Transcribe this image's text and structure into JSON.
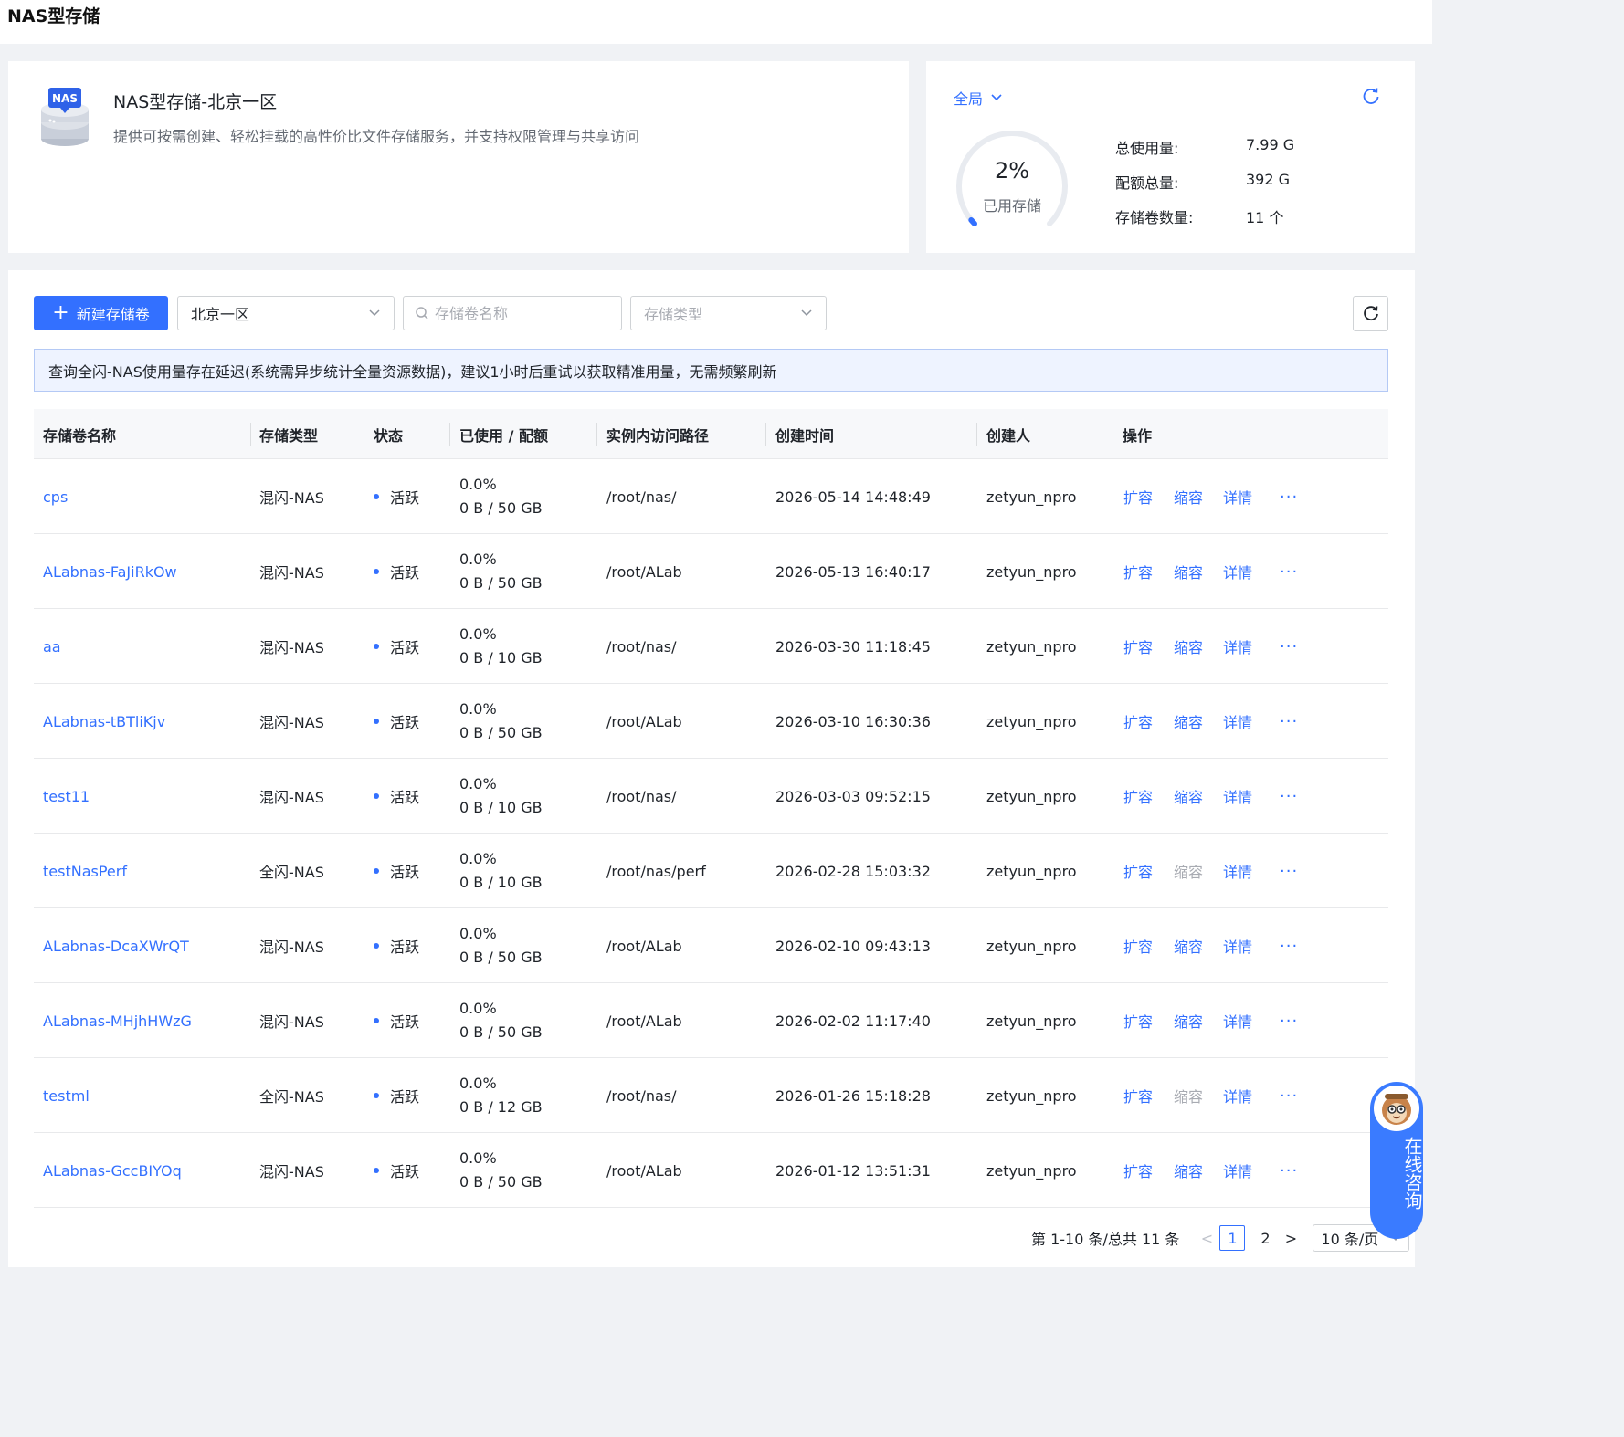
{
  "page": {
    "title": "NAS型存储"
  },
  "info": {
    "logo_text": "NAS",
    "title": "NAS型存储-北京一区",
    "description": "提供可按需创建、轻松挂载的高性价比文件存储服务，并支持权限管理与共享访问"
  },
  "stats": {
    "scope": "全局",
    "used_percent_value": 2,
    "used_percent": "2%",
    "used_label": "已用存储",
    "total_usage_label": "总使用量:",
    "total_usage": "7.99 G",
    "quota_label": "配额总量:",
    "quota": "392 G",
    "volume_count_label": "存储卷数量:",
    "volume_count": "11 个",
    "accent": "#3370ff"
  },
  "toolbar": {
    "new_label": "新建存储卷",
    "region": "北京一区",
    "search_placeholder": "存储卷名称",
    "type_placeholder": "存储类型"
  },
  "notice": "查询全闪-NAS使用量存在延迟(系统需异步统计全量资源数据)，建议1小时后重试以获取精准用量，无需频繁刷新",
  "table": {
    "headers": {
      "name": "存储卷名称",
      "type": "存储类型",
      "status": "状态",
      "usage": "已使用 / 配额",
      "path": "实例内访问路径",
      "created": "创建时间",
      "creator": "创建人",
      "actions": "操作"
    },
    "action_labels": {
      "expand": "扩容",
      "shrink": "缩容",
      "detail": "详情",
      "more": "···"
    },
    "rows": [
      {
        "name": "cps",
        "type": "混闪-NAS",
        "status": "活跃",
        "pct": "0.0%",
        "usage": "0 B / 50 GB",
        "path": "/root/nas/",
        "created": "2026-05-14 14:48:49",
        "creator": "zetyun_npro",
        "shrink_enabled": true
      },
      {
        "name": "ALabnas-FaJiRkOw",
        "type": "混闪-NAS",
        "status": "活跃",
        "pct": "0.0%",
        "usage": "0 B / 50 GB",
        "path": "/root/ALab",
        "created": "2026-05-13 16:40:17",
        "creator": "zetyun_npro",
        "shrink_enabled": true
      },
      {
        "name": "aa",
        "type": "混闪-NAS",
        "status": "活跃",
        "pct": "0.0%",
        "usage": "0 B / 10 GB",
        "path": "/root/nas/",
        "created": "2026-03-30 11:18:45",
        "creator": "zetyun_npro",
        "shrink_enabled": true
      },
      {
        "name": "ALabnas-tBTliKjv",
        "type": "混闪-NAS",
        "status": "活跃",
        "pct": "0.0%",
        "usage": "0 B / 50 GB",
        "path": "/root/ALab",
        "created": "2026-03-10 16:30:36",
        "creator": "zetyun_npro",
        "shrink_enabled": true
      },
      {
        "name": "test11",
        "type": "混闪-NAS",
        "status": "活跃",
        "pct": "0.0%",
        "usage": "0 B / 10 GB",
        "path": "/root/nas/",
        "created": "2026-03-03 09:52:15",
        "creator": "zetyun_npro",
        "shrink_enabled": true
      },
      {
        "name": "testNasPerf",
        "type": "全闪-NAS",
        "status": "活跃",
        "pct": "0.0%",
        "usage": "0 B / 10 GB",
        "path": "/root/nas/perf",
        "created": "2026-02-28 15:03:32",
        "creator": "zetyun_npro",
        "shrink_enabled": false
      },
      {
        "name": "ALabnas-DcaXWrQT",
        "type": "混闪-NAS",
        "status": "活跃",
        "pct": "0.0%",
        "usage": "0 B / 50 GB",
        "path": "/root/ALab",
        "created": "2026-02-10 09:43:13",
        "creator": "zetyun_npro",
        "shrink_enabled": true
      },
      {
        "name": "ALabnas-MHjhHWzG",
        "type": "混闪-NAS",
        "status": "活跃",
        "pct": "0.0%",
        "usage": "0 B / 50 GB",
        "path": "/root/ALab",
        "created": "2026-02-02 11:17:40",
        "creator": "zetyun_npro",
        "shrink_enabled": true
      },
      {
        "name": "testml",
        "type": "全闪-NAS",
        "status": "活跃",
        "pct": "0.0%",
        "usage": "0 B / 12 GB",
        "path": "/root/nas/",
        "created": "2026-01-26 15:18:28",
        "creator": "zetyun_npro",
        "shrink_enabled": false
      },
      {
        "name": "ALabnas-GccBIYOq",
        "type": "混闪-NAS",
        "status": "活跃",
        "pct": "0.0%",
        "usage": "0 B / 50 GB",
        "path": "/root/ALab",
        "created": "2026-01-12 13:51:31",
        "creator": "zetyun_npro",
        "shrink_enabled": true
      }
    ]
  },
  "pagination": {
    "summary": "第 1-10 条/总共 11 条",
    "pages": [
      "1",
      "2"
    ],
    "current": "1",
    "page_size": "10 条/页"
  },
  "consult": {
    "label": "在线咨询"
  }
}
